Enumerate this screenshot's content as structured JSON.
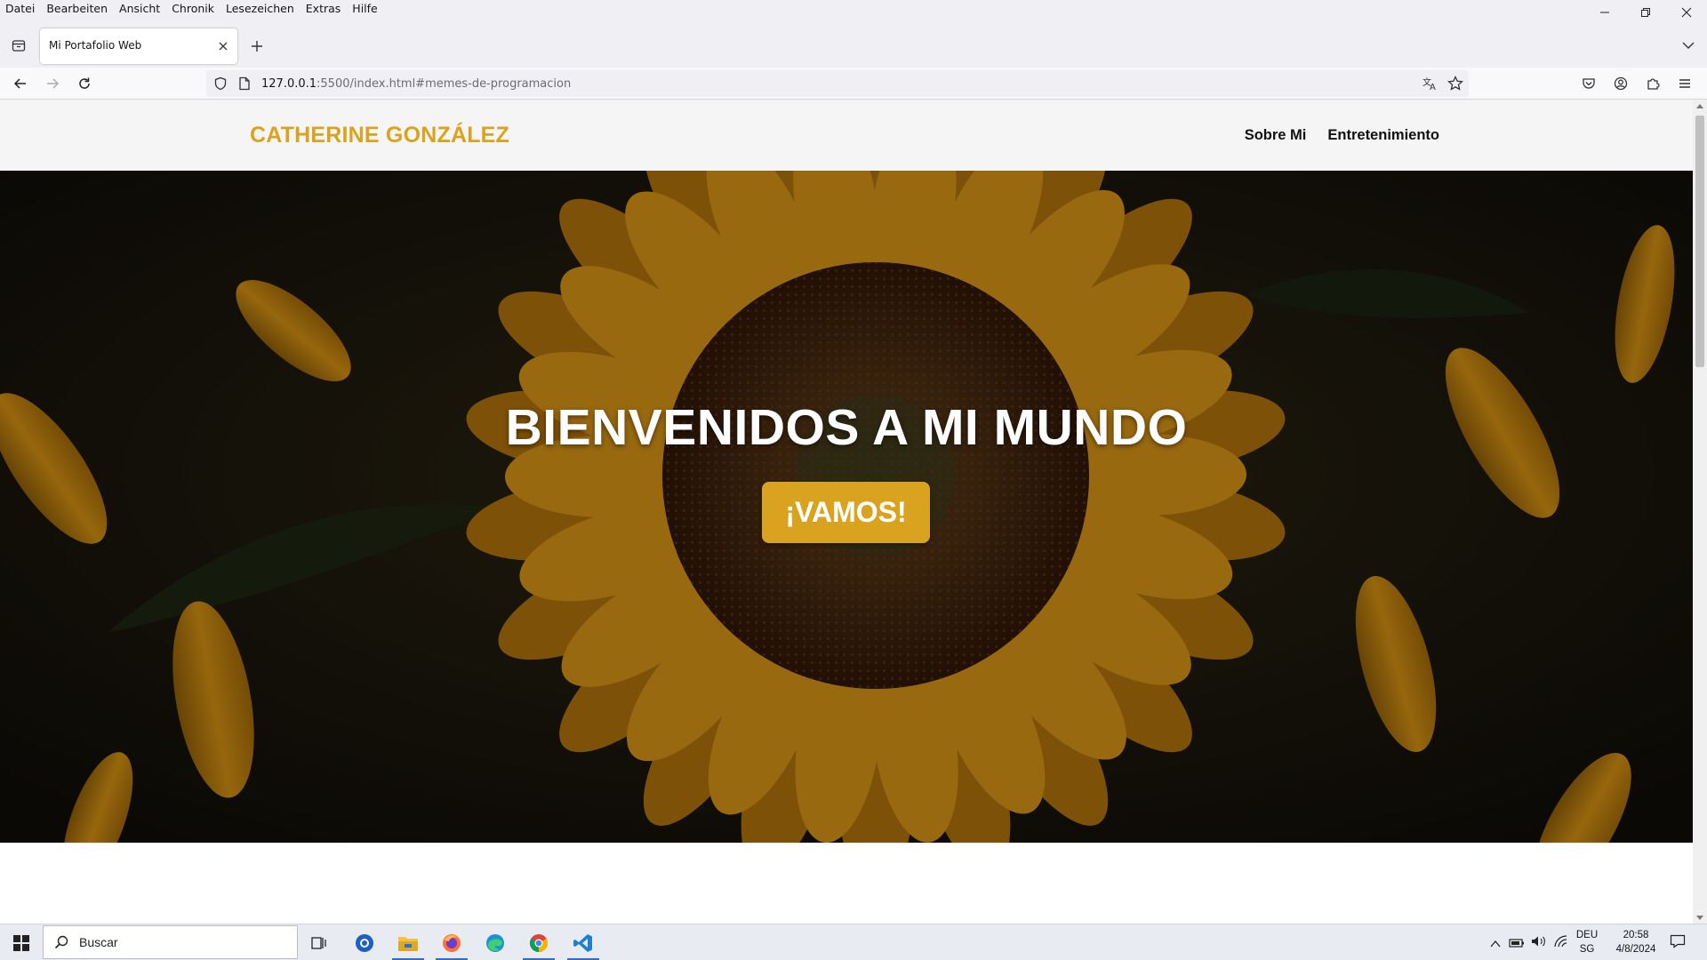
{
  "menubar": {
    "items": [
      "Datei",
      "Bearbeiten",
      "Ansicht",
      "Chronik",
      "Lesezeichen",
      "Extras",
      "Hilfe"
    ]
  },
  "tab": {
    "title": "Mi Portafolio Web"
  },
  "urlbar": {
    "host": "127.0.0.1",
    "path": ":5500/index.html#memes-de-programacion"
  },
  "site": {
    "logo": "CATHERINE GONZÁLEZ",
    "nav": [
      "Sobre Mi",
      "Entretenimiento"
    ],
    "hero_title": "BIENVENIDOS A MI MUNDO",
    "hero_button": "¡VAMOS!",
    "accent_color": "#d9a320"
  },
  "taskbar": {
    "search_placeholder": "Buscar",
    "apps": [
      "task-view-icon",
      "support-assistant-icon",
      "file-explorer-icon",
      "firefox-icon",
      "edge-icon",
      "chrome-icon",
      "vscode-icon"
    ],
    "lang_line1": "DEU",
    "lang_line2": "SG",
    "time": "20:58",
    "date": "4/8/2024"
  }
}
